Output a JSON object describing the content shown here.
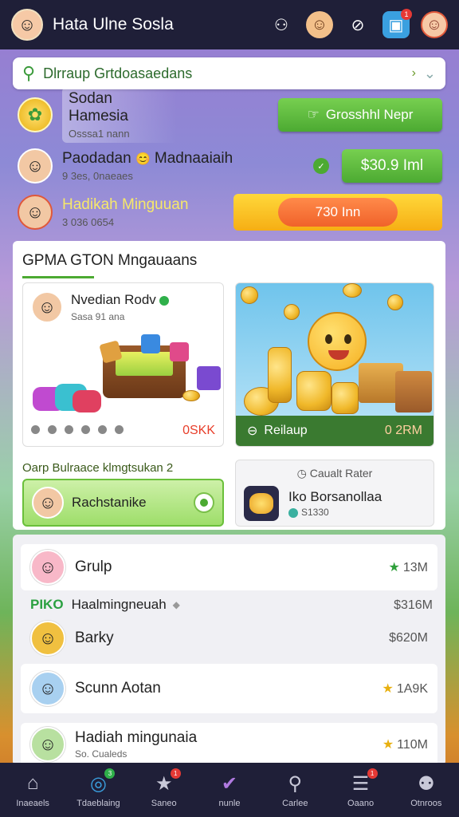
{
  "app": {
    "title": "Hata Ulne Sosla"
  },
  "topbar": {
    "icons": [
      {
        "name": "group-icon",
        "glyph": "⚇"
      },
      {
        "name": "profile-avatar-icon",
        "glyph": "☺"
      },
      {
        "name": "compass-icon",
        "glyph": "⊘"
      },
      {
        "name": "chat-icon",
        "glyph": "▣",
        "badge": "1"
      },
      {
        "name": "user-avatar-icon",
        "glyph": "☺"
      }
    ]
  },
  "search": {
    "value": "Dlrraup Grtdoasaedans",
    "arrow": "›",
    "chevron": "⌄"
  },
  "promos": [
    {
      "name": "Sodan Hamesia",
      "sub": "Osssa1 nann",
      "button": "Grosshhl Nepr"
    },
    {
      "name": "Paodadan",
      "emoji": "😊",
      "name2": "Madnaaiaih",
      "sub": "9 3es, 0naeaes",
      "button": "$30.9 Iml"
    },
    {
      "name": "Hadikah Minguuan",
      "sub": "3 036 0654",
      "button": "730 Inn"
    }
  ],
  "panel": {
    "title": "GPMA GTON Mngauaans",
    "card1": {
      "title": "Nvedian Rodv",
      "sub": "Sasa 91 ana",
      "value": "0SKK"
    },
    "card2": {
      "label": "Reilaup",
      "value": "0 2RM"
    },
    "ranking_label": "Oarp Bulraace klmgtsukan 2",
    "highlight": {
      "name": "Rachstanike"
    },
    "side": {
      "header": "Caualt Rater",
      "name": "Iko Borsanollaa",
      "sub": "S1330"
    }
  },
  "list": {
    "rows": [
      {
        "name": "Grulp",
        "value": "13M",
        "star": "★"
      },
      {
        "name": "Barky",
        "value": "$620M"
      },
      {
        "name": "Scunn Aotan",
        "value": "1A9K",
        "star": "★"
      },
      {
        "name": "Hadiah mingunaia",
        "value": "110M",
        "star": "★",
        "sub": "So. Cualeds"
      }
    ],
    "subheader": {
      "tag": "PIKO",
      "label": "Haalmingneuah",
      "diamond": "◆",
      "value": "$316M"
    }
  },
  "nav": [
    {
      "label": "Inaeaels",
      "icon": "home-icon",
      "glyph": "⌂"
    },
    {
      "label": "Tdaeblaing",
      "icon": "target-icon",
      "glyph": "◎",
      "badge": "3"
    },
    {
      "label": "Saneo",
      "icon": "star-icon",
      "glyph": "★",
      "badge": "1"
    },
    {
      "label": "nunle",
      "icon": "check-circle-icon",
      "glyph": "✔",
      "active": true
    },
    {
      "label": "Carlee",
      "icon": "search-icon",
      "glyph": "⚲"
    },
    {
      "label": "Oaano",
      "icon": "menu-icon",
      "glyph": "☰",
      "badge": "1"
    },
    {
      "label": "Otnroos",
      "icon": "person-icon",
      "glyph": "⚉"
    }
  ],
  "colors": {
    "accent": "#4caa32",
    "topbar": "#1f1f38",
    "yellow": "#f6ae14",
    "orange": "#f0622a"
  }
}
